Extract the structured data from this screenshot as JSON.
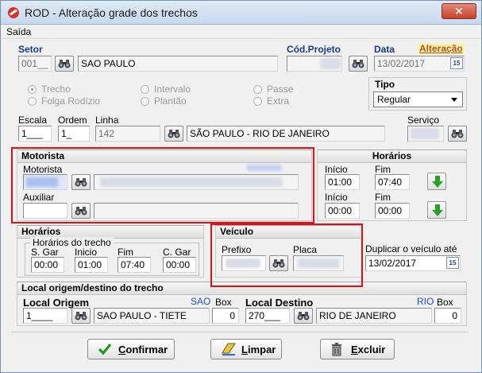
{
  "window": {
    "title": "ROD - Alteração grade dos trechos"
  },
  "menu": {
    "items": [
      "Saída"
    ]
  },
  "setor": {
    "label": "Setor",
    "code": "001__",
    "name": "SAO PAULO"
  },
  "projeto": {
    "label": "Cód.Projeto",
    "value": ""
  },
  "data": {
    "label": "Data",
    "mode_badge": "Alteração",
    "value": "13/02/2017"
  },
  "trecho_options": {
    "trecho": "Trecho",
    "folga": "Folga Rodízio",
    "intervalo": "Intervalo",
    "plantao": "Plantão",
    "passe": "Passe",
    "extra": "Extra",
    "selected": "Trecho"
  },
  "tipo": {
    "label": "Tipo",
    "value": "Regular"
  },
  "escala": {
    "label": "Escala",
    "value": "1___"
  },
  "ordem": {
    "label": "Ordem",
    "value": "1_"
  },
  "linha": {
    "label": "Linha",
    "code": "142",
    "name": "SÃO PAULO - RIO DE JANEIRO"
  },
  "servico": {
    "label": "Serviço",
    "value": ""
  },
  "motorista_group": {
    "title": "Motorista",
    "motorista_label": "Motorista",
    "auxiliar_label": "Auxiliar"
  },
  "horarios_right": {
    "title": "Horários",
    "inicio_label": "Início",
    "fim_label": "Fim",
    "row1": {
      "inicio": "01:00",
      "fim": "07:40"
    },
    "row2": {
      "inicio": "00:00",
      "fim": "00:00"
    }
  },
  "horarios_left": {
    "title": "Horários",
    "subtitle": "Horários do trecho",
    "cols": [
      "S. Gar",
      "Inicio",
      "Fim",
      "C. Gar"
    ],
    "values": [
      "00:00",
      "01:00",
      "07:40",
      "00:00"
    ]
  },
  "veiculo": {
    "title": "Veículo",
    "prefixo_label": "Prefixo",
    "placa_label": "Placa"
  },
  "duplicar": {
    "label": "Duplicar o veículo até",
    "value": "13/02/2017"
  },
  "local_group": {
    "title": "Local origem/destino do trecho"
  },
  "origem": {
    "label": "Local Origem",
    "code_tag": "SAO",
    "box_label": "Box",
    "code": "1____",
    "name": "SAO PAULO - TIETE",
    "box": "0"
  },
  "destino": {
    "label": "Local Destino",
    "code_tag": "RIO",
    "box_label": "Box",
    "code": "270___",
    "name": "RIO DE JANEIRO",
    "box": "0"
  },
  "actions": {
    "confirmar": "onfirmar",
    "confirmar_key": "C",
    "limpar": "impar",
    "limpar_key": "L",
    "excluir": "xcluir",
    "excluir_key": "E"
  },
  "colors": {
    "accent": "#1a3a8a",
    "highlight": "#e20f1b",
    "badge_bg": "#fff3b0"
  }
}
